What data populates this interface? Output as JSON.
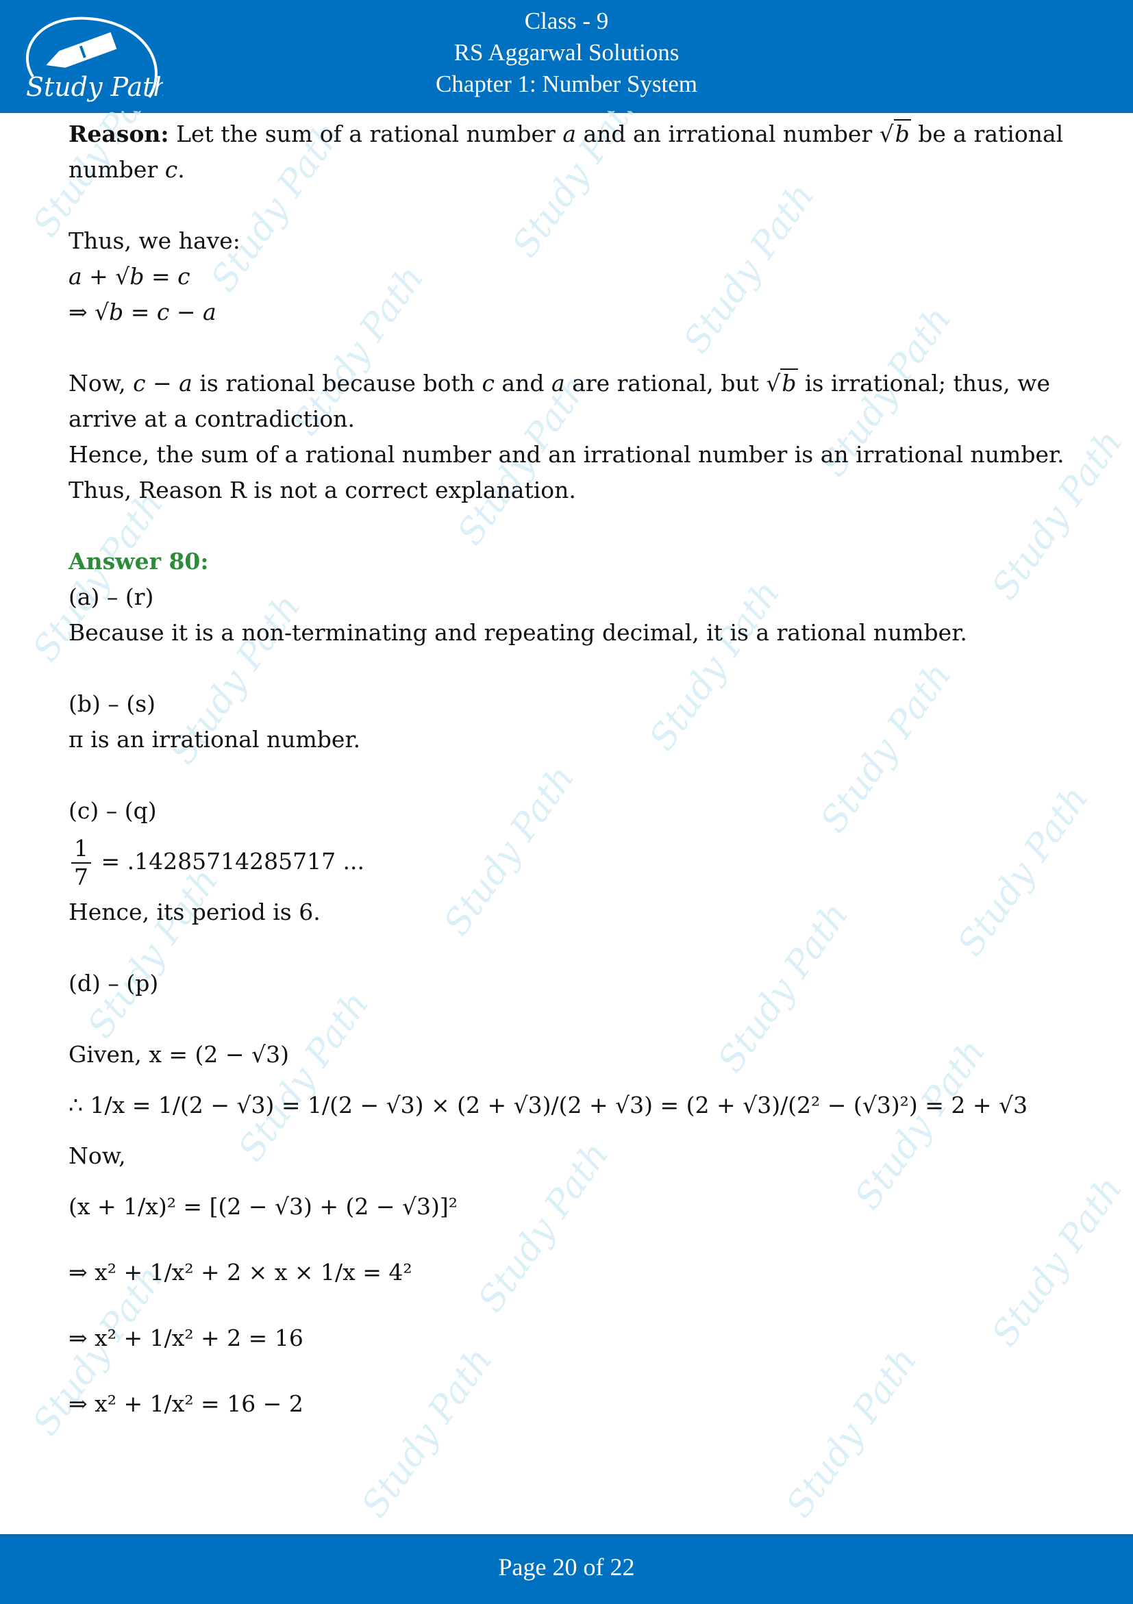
{
  "header": {
    "logo_text": "Study Path",
    "class_label": "Class - 9",
    "book_label": "RS Aggarwal Solutions",
    "chapter_label": "Chapter 1: Number System"
  },
  "watermark_text": "Study Path",
  "reason": {
    "label": "Reason:",
    "line1_a": " Let the sum of a rational number ",
    "var_a": "a",
    "line1_b": " and an irrational number ",
    "var_b": "b",
    "line1_c": " be a rational number ",
    "var_c": "c",
    "line1_end": ".",
    "thus": "Thus, we have:",
    "eq1": "a + √b = c",
    "eq2": "⇒ √b = c − a",
    "now_a": "Now, ",
    "now_expr": "c − a",
    "now_b": " is rational because both ",
    "now_c": " and ",
    "now_d": " are rational, but ",
    "now_e": " is irrational; thus, we arrive at a contradiction.",
    "hence": "Hence, the sum of a rational number and an irrational number is an irrational number.",
    "conclusion": "Thus, Reason R is not a correct explanation."
  },
  "answer": {
    "heading": "Answer 80:",
    "a_match": "(a) – (r)",
    "a_text": " Because it is a non-terminating and repeating decimal, it is a rational number.",
    "b_match": "(b) – (s)",
    "b_text": "π is an irrational number.",
    "c_match": "(c) – (q)",
    "c_frac_num": "1",
    "c_frac_den": "7",
    "c_decimal": "= .14285714285717 ...",
    "c_period": "Hence, its period is 6.",
    "d_match": "(d) – (p)",
    "given": "Given, x = (2 − √3)",
    "step1": "∴ 1/x = 1/(2 − √3) = 1/(2 − √3) × (2 + √3)/(2 + √3) = (2 + √3)/(2² − (√3)²) = 2 + √3",
    "now": "Now,",
    "step2": "(x + 1/x)² = [(2 − √3) + (2 − √3)]²",
    "step3": "⇒ x² + 1/x² + 2 × x × 1/x = 4²",
    "step4": "⇒ x² + 1/x² + 2 = 16",
    "step5": "⇒ x² + 1/x² = 16 − 2"
  },
  "footer": {
    "page_text": "Page 20 of 22"
  }
}
